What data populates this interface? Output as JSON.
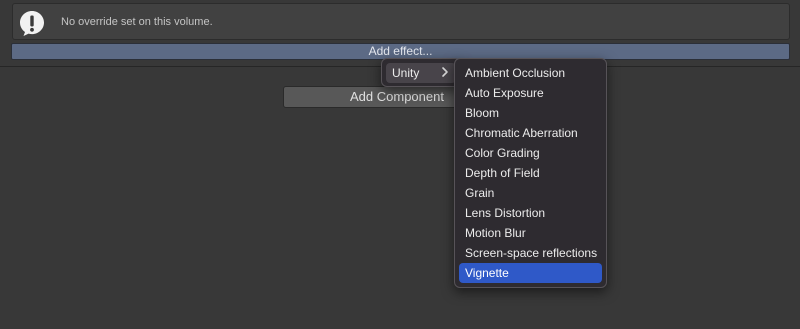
{
  "helpbox": {
    "icon": "warning-exclamation-icon",
    "message": "No override set on this volume."
  },
  "add_effect": {
    "label": "Add effect..."
  },
  "add_component": {
    "label": "Add Component"
  },
  "menu": {
    "root_items": [
      {
        "label": "Unity",
        "icon": "chevron-right-icon"
      }
    ],
    "submenu_items": [
      {
        "label": "Ambient Occlusion",
        "selected": false
      },
      {
        "label": "Auto Exposure",
        "selected": false
      },
      {
        "label": "Bloom",
        "selected": false
      },
      {
        "label": "Chromatic Aberration",
        "selected": false
      },
      {
        "label": "Color Grading",
        "selected": false
      },
      {
        "label": "Depth of Field",
        "selected": false
      },
      {
        "label": "Grain",
        "selected": false
      },
      {
        "label": "Lens Distortion",
        "selected": false
      },
      {
        "label": "Motion Blur",
        "selected": false
      },
      {
        "label": "Screen-space reflections",
        "selected": false
      },
      {
        "label": "Vignette",
        "selected": true
      }
    ]
  },
  "colors": {
    "background": "#383838",
    "add_effect_bar": "#5c6a85",
    "menu_background": "#2e2b30",
    "selection": "#2f59c8"
  }
}
